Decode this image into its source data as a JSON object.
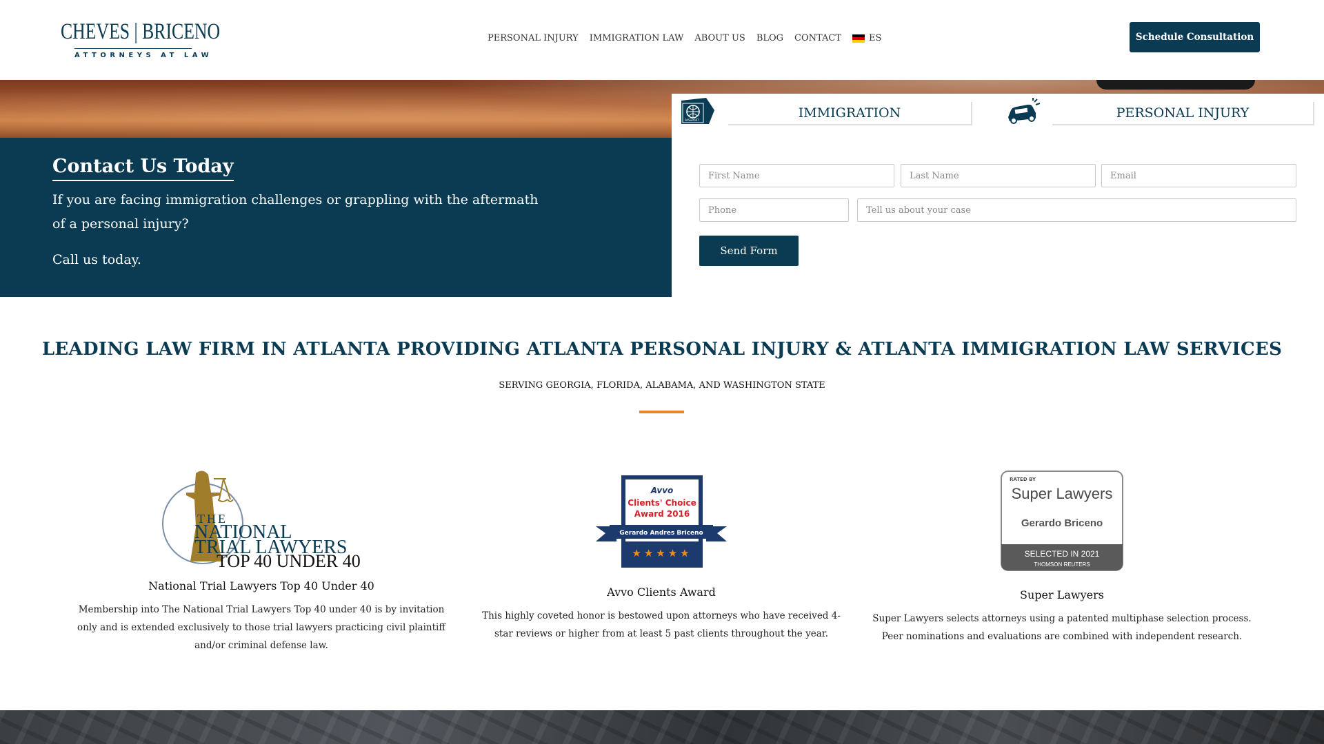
{
  "brand": {
    "name": "CHEVES | BRICENO",
    "tagline": "ATTORNEYS AT LAW"
  },
  "nav": {
    "items": [
      "PERSONAL INJURY",
      "IMMIGRATION LAW",
      "ABOUT US",
      "BLOG",
      "CONTACT"
    ],
    "lang_label": "ES"
  },
  "header": {
    "cta_label": "Schedule Consultation"
  },
  "contact": {
    "title": "Contact Us Today",
    "text": "If you are facing immigration challenges or grappling with the aftermath of a personal injury?",
    "call": "Call us today."
  },
  "form": {
    "tabs": [
      "IMMIGRATION",
      "PERSONAL INJURY"
    ],
    "placeholders": {
      "first_name": "First Name",
      "last_name": "Last Name",
      "email": "Email",
      "phone": "Phone",
      "message": "Tell us about your case"
    },
    "submit_label": "Send Form"
  },
  "main": {
    "headline": "LEADING LAW FIRM IN ATLANTA PROVIDING ATLANTA PERSONAL INJURY & ATLANTA IMMIGRATION LAW SERVICES",
    "subline": "SERVING GEORGIA, FLORIDA, ALABAMA, AND WASHINGTON STATE"
  },
  "awards": [
    {
      "logo_lines": [
        "THE",
        "NATIONAL",
        "TRIAL LAWYERS",
        "TOP 40 UNDER 40"
      ],
      "title": "National Trial Lawyers Top 40 Under 40",
      "desc": "Membership into The National Trial Lawyers Top 40 under 40 is by invitation only and is extended exclusively to those trial lawyers practicing civil plaintiff and/or criminal defense law."
    },
    {
      "logo_lines": [
        "Avvo",
        "Clients' Choice",
        "Award 2016",
        "Gerardo Andres Briceno",
        "★★★★★"
      ],
      "title": "Avvo Clients Award",
      "desc": "This highly coveted honor is bestowed upon attorneys who have received 4-star reviews or higher from at least 5 past clients throughout the year."
    },
    {
      "logo_lines": [
        "RATED BY",
        "Super Lawyers",
        "Gerardo Briceno",
        "SELECTED IN 2021",
        "THOMSON REUTERS"
      ],
      "title": "Super Lawyers",
      "desc": "Super Lawyers selects attorneys using a patented multiphase selection process. Peer nominations and evaluations are combined with independent research."
    }
  ],
  "colors": {
    "primary": "#0b3b53",
    "accent": "#e9852a",
    "gold": "#a07d2a"
  }
}
